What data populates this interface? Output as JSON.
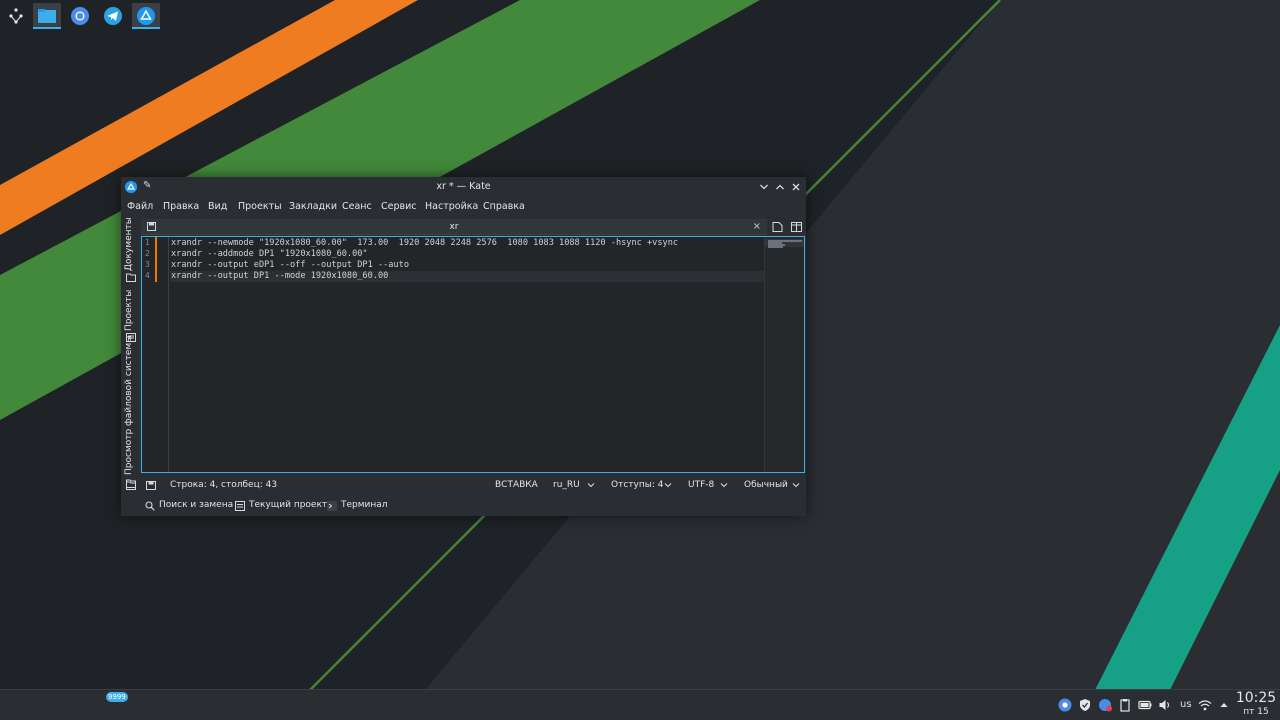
{
  "window": {
    "title": "xr * — Kate"
  },
  "menu": {
    "items": [
      "Файл",
      "Правка",
      "Вид",
      "Проекты",
      "Закладки",
      "Сеанс",
      "Сервис",
      "Настройка",
      "Справка"
    ]
  },
  "sidebar": {
    "tabs": [
      "Документы",
      "Проекты",
      "Просмотр файловой системы"
    ]
  },
  "tab": {
    "title": "xr",
    "close_glyph": "×"
  },
  "editor": {
    "line_numbers": [
      "1",
      "2",
      "3",
      "4"
    ],
    "lines": [
      "xrandr --newmode \"1920x1080_60.00\"  173.00  1920 2048 2248 2576  1080 1083 1088 1120 -hsync +vsync",
      "xrandr --addmode DP1 \"1920x1080_60.00\"",
      "xrandr --output eDP1 --off --output DP1 --auto",
      "xrandr --output DP1 --mode 1920x1080_60.00"
    ]
  },
  "status": {
    "cursor": "Строка: 4, столбец: 43",
    "mode": "ВСТАВКА",
    "spell_lang": "ru_RU",
    "indent": "Отступы: 4",
    "encoding": "UTF-8",
    "highlight": "Обычный"
  },
  "toolviews": {
    "search": "Поиск и замена",
    "project": "Текущий проект",
    "terminal": "Терминал"
  },
  "taskbar": {
    "badge": "9999",
    "keyboard_layout": "us",
    "time": "10:25",
    "date": "пт 15"
  },
  "colors": {
    "accent": "#3daee9",
    "modified_marker": "#f67400",
    "wallpaper_orange": "#f07c22",
    "wallpaper_green": "#42893b",
    "wallpaper_teal": "#16a085"
  }
}
